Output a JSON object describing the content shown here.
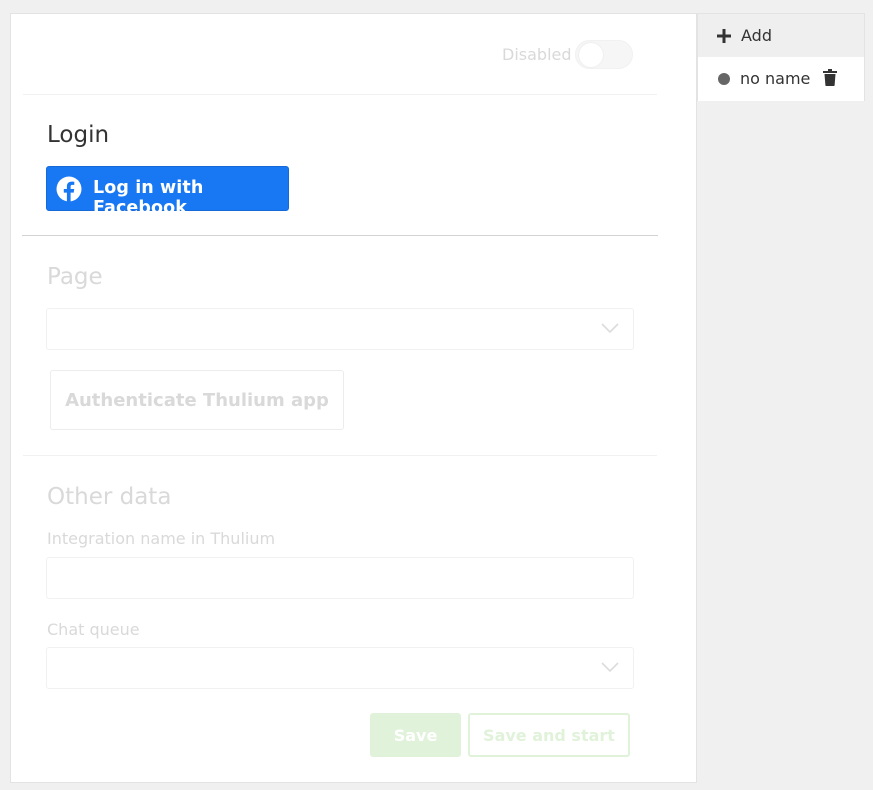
{
  "header": {
    "toggle_label": "Disabled",
    "toggle_state": "off"
  },
  "login": {
    "title": "Login",
    "facebook_button_label": "Log in with Facebook",
    "facebook_color": "#1877f2"
  },
  "page_section": {
    "title": "Page",
    "select_value": "",
    "auth_button_label": "Authenticate Thulium app"
  },
  "other_data": {
    "title": "Other data",
    "integration_name_label": "Integration name in Thulium",
    "integration_name_value": "",
    "chat_queue_label": "Chat queue",
    "chat_queue_value": ""
  },
  "actions": {
    "save_label": "Save",
    "save_and_start_label": "Save and start",
    "accent_color": "#e1f2da"
  },
  "sidebar": {
    "add_label": "Add",
    "items": [
      {
        "label": "no name",
        "icon": "dot-icon"
      }
    ]
  }
}
